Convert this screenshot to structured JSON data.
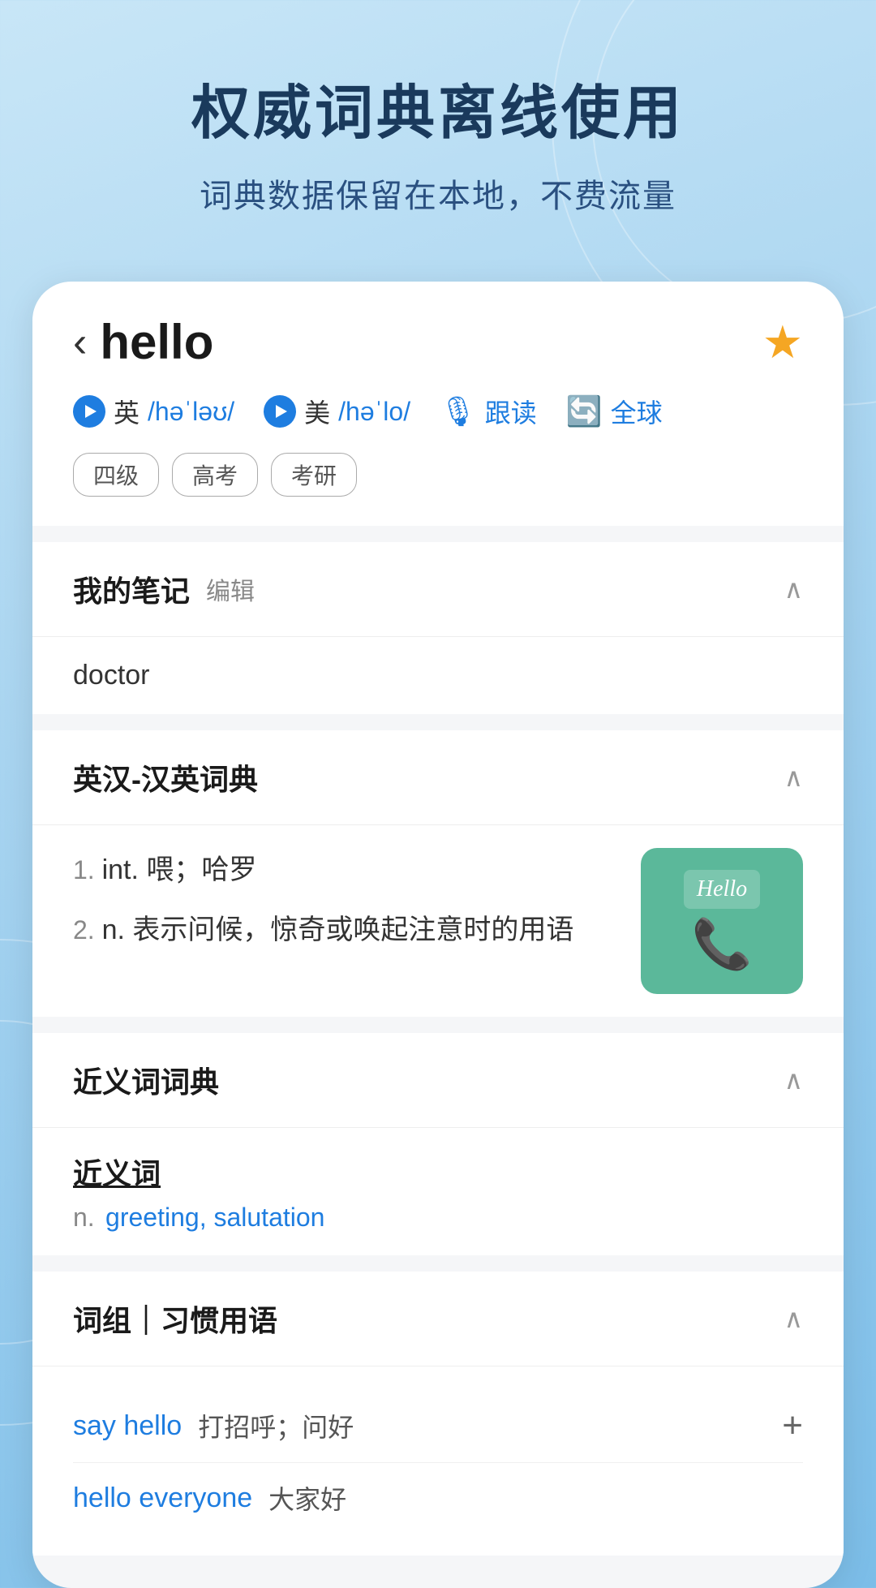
{
  "background": {
    "title": "权威词典离线使用",
    "subtitle": "词典数据保留在本地，不费流量"
  },
  "word": {
    "back_label": "‹",
    "text": "hello",
    "star_icon": "★",
    "pron_en_label": "英",
    "pron_en_value": "/həˈləʊ/",
    "pron_us_label": "美",
    "pron_us_value": "/həˈlo/",
    "follow_read_label": "跟读",
    "global_label": "全球",
    "tags": [
      "四级",
      "高考",
      "考研"
    ]
  },
  "sections": {
    "my_notes": {
      "title": "我的笔记",
      "edit_label": "编辑",
      "chevron": "∧",
      "content": "doctor"
    },
    "en_cn_dict": {
      "title": "英汉-汉英词典",
      "chevron": "∧",
      "definitions": [
        {
          "number": "1.",
          "pos": "int.",
          "meaning": "喂；哈罗"
        },
        {
          "number": "2.",
          "pos": "n.",
          "meaning": "表示问候，惊奇或唤起注意时的用语"
        }
      ],
      "image_alt": "Hello telephone illustration",
      "image_hello_text": "Hello"
    },
    "synonym_dict": {
      "title": "近义词词典",
      "chevron": "∧",
      "synonym_section_title": "近义词",
      "synonym_pos": "n.",
      "synonym_words": "greeting, salutation"
    },
    "phrases": {
      "title": "词组｜习惯用语",
      "chevron": "∧",
      "items": [
        {
          "phrase": "say hello",
          "meaning": "打招呼；问好",
          "has_add": true
        },
        {
          "phrase": "hello everyone",
          "meaning": "大家好",
          "has_add": false
        }
      ]
    }
  }
}
